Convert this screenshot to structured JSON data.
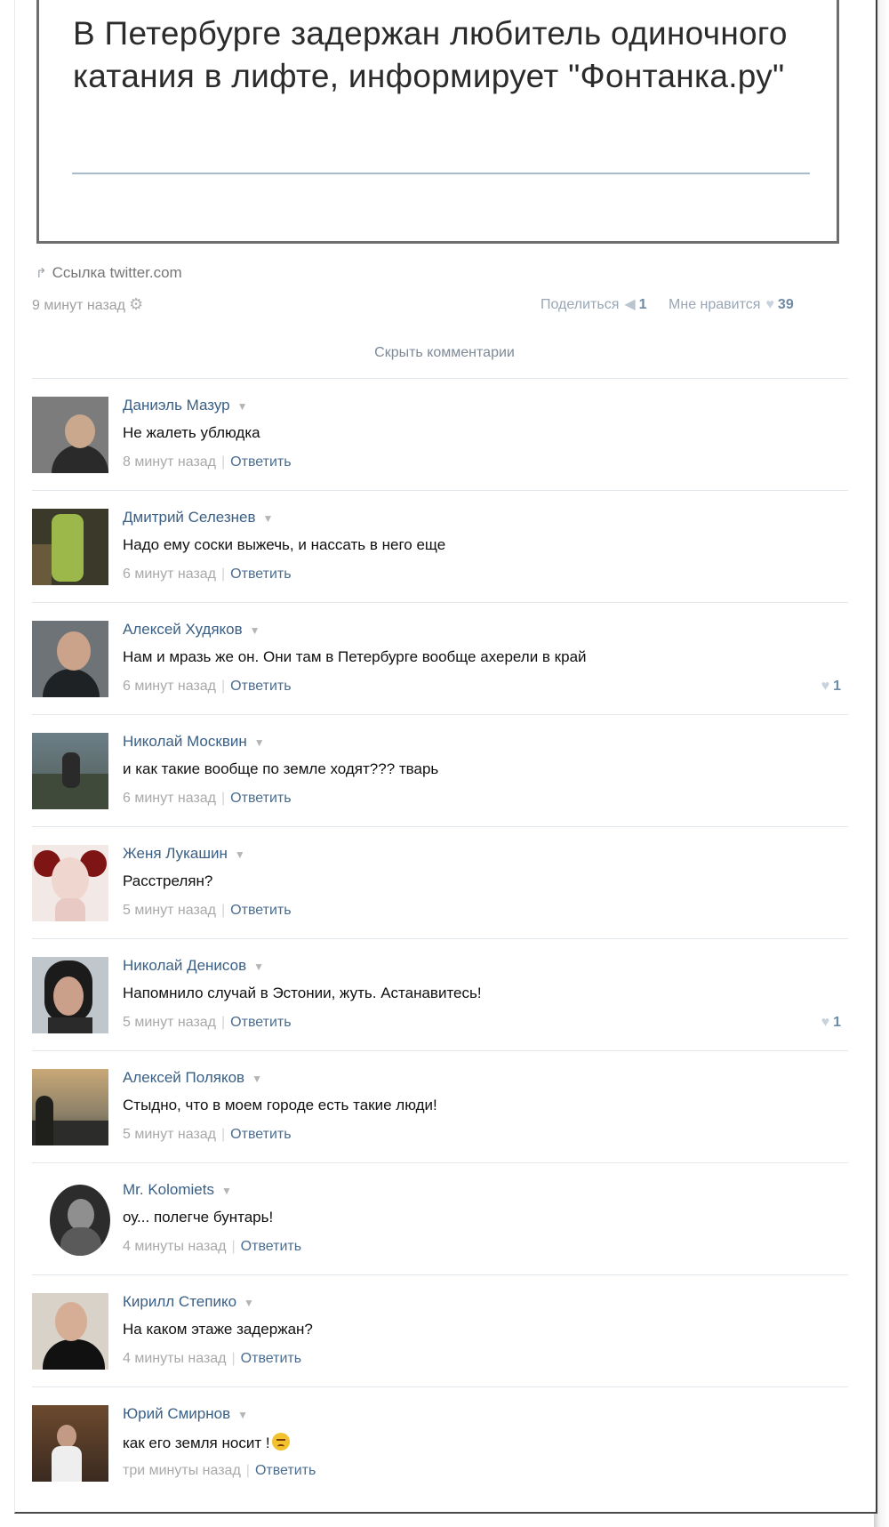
{
  "post": {
    "title": "В Петербурге задержан любитель одиночного катания в лифте, информирует \"Фонтанка.ру\"",
    "link_label": "Ссылка twitter.com",
    "time": "9 минут назад",
    "share_label": "Поделиться",
    "share_count": "1",
    "like_label": "Мне нравится",
    "like_count": "39",
    "hide_comments": "Скрыть комментарии"
  },
  "icons": {
    "link": "external-link-icon",
    "settings": "gear-icon",
    "share": "megaphone-icon",
    "like": "heart-icon",
    "menu": "caret-down-icon"
  },
  "comments": [
    {
      "author": "Даниэль Мазур",
      "text": "Не жалеть ублюдка",
      "time": "8 минут назад",
      "reply": "Ответить",
      "likes": ""
    },
    {
      "author": "Дмитрий Селезнев",
      "text": "Надо ему соски выжечь, и нассать в него еще",
      "time": "6 минут назад",
      "reply": "Ответить",
      "likes": ""
    },
    {
      "author": "Алексей Худяков",
      "text": "Нам и мразь же он. Они там в Петербурге вообще ахерели в край",
      "time": "6 минут назад",
      "reply": "Ответить",
      "likes": "1"
    },
    {
      "author": "Николай Москвин",
      "text": "и как такие вообще по земле ходят??? тварь",
      "time": "6 минут назад",
      "reply": "Ответить",
      "likes": ""
    },
    {
      "author": "Женя Лукашин",
      "text": "Расстрелян?",
      "time": "5 минут назад",
      "reply": "Ответить",
      "likes": ""
    },
    {
      "author": "Николай Денисов",
      "text": "Напомнило случай в Эстонии, жуть. Астанавитесь!",
      "time": "5 минут назад",
      "reply": "Ответить",
      "likes": "1"
    },
    {
      "author": "Алексей Поляков",
      "text": "Стыдно, что в моем городе есть такие люди!",
      "time": "5 минут назад",
      "reply": "Ответить",
      "likes": ""
    },
    {
      "author": "Mr. Kolomiets",
      "text": "оу... полегче бунтарь!",
      "time": "4 минуты назад",
      "reply": "Ответить",
      "likes": ""
    },
    {
      "author": "Кирилл Степико",
      "text": "На каком этаже задержан?",
      "time": "4 минуты назад",
      "reply": "Ответить",
      "likes": ""
    },
    {
      "author": "Юрий Смирнов",
      "text": "как его земля носит !",
      "time": "три минуты назад",
      "reply": "Ответить",
      "likes": ""
    }
  ],
  "colors": {
    "link_blue": "#3a5f85",
    "meta_gray": "#a9a9a9",
    "divider": "#e3e8ed"
  }
}
